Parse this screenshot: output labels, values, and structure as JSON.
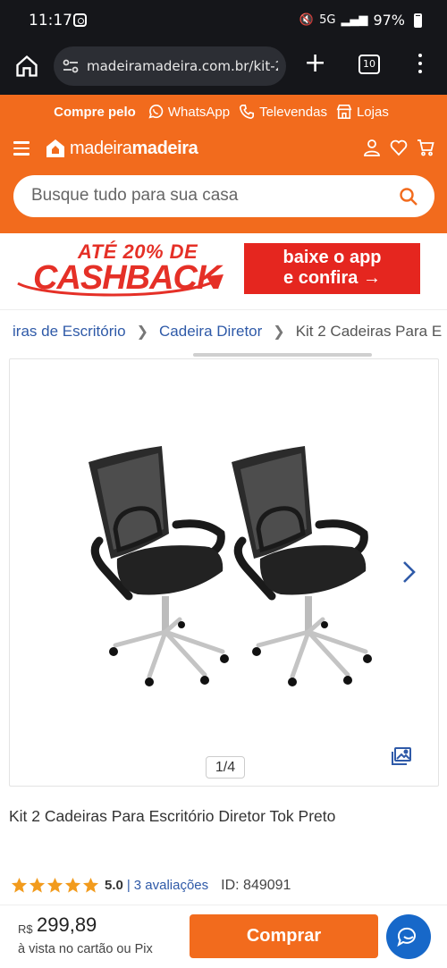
{
  "status_bar": {
    "time": "11:17",
    "signal_label": "5G",
    "battery": "97%",
    "battery_level": 0.97
  },
  "browser": {
    "url": "madeiramadeira.com.br/kit-2-c",
    "tab_count": "10"
  },
  "header": {
    "compre_pelo": "Compre pelo",
    "whatsapp": "WhatsApp",
    "televendas": "Televendas",
    "lojas": "Lojas",
    "logo_light": "madeira",
    "logo_bold": "madeira",
    "search_placeholder": "Busque tudo para sua casa",
    "accent_color": "#f26b1d"
  },
  "banner": {
    "top_text": "ATÉ 20% DE",
    "main_text": "CASHBACK",
    "app_line1": "baixe o app",
    "app_line2": "e confira →",
    "banner_color": "#e5261f"
  },
  "breadcrumb": {
    "items": [
      "iras de Escritório",
      "Cadeira Diretor"
    ],
    "current": "Kit 2 Cadeiras Para E"
  },
  "gallery": {
    "counter": "1/4"
  },
  "product": {
    "title": "Kit 2 Cadeiras Para Escritório Diretor Tok Preto",
    "rating": "5.0",
    "rating_sep": "|",
    "reviews": "3 avaliações",
    "id_label": "ID: 849091",
    "stars": 5
  },
  "purchase": {
    "currency": "R$",
    "price": "299,89",
    "price_note": "à vista no cartão ou Pix",
    "buy_label": "Comprar"
  }
}
